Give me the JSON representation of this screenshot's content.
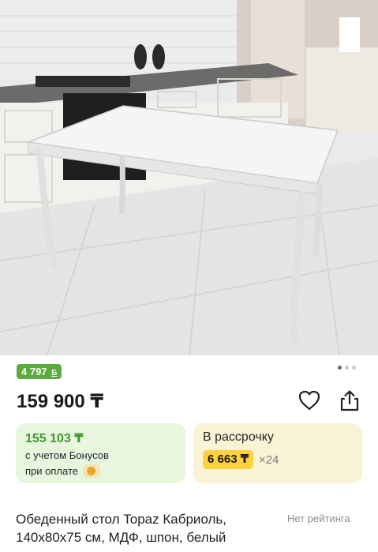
{
  "product": {
    "bonus_badge": "4 797",
    "bonus_badge_unit": "Б",
    "price": "159 900 ₸",
    "title": "Обеденный стол Topaz Кабриоль, 140х80х75 см, МДФ, шпон, белый",
    "rating_text": "Нет рейтинга"
  },
  "gallery": {
    "total_images": 3,
    "active_index": 0
  },
  "bonus_card": {
    "price": "155 103 ₸",
    "line1": "с учетом Бонусов",
    "line2": "при оплате"
  },
  "installment_card": {
    "title": "В рассрочку",
    "monthly": "6 663 ₸",
    "multiplier": "×24"
  },
  "icons": {
    "favorite": "heart-icon",
    "share": "share-icon",
    "payment": "coin-icon"
  },
  "colors": {
    "bonus_green": "#5cab3f",
    "bonus_price_green": "#3d9a2c",
    "installment_yellow": "#ffd23d"
  }
}
